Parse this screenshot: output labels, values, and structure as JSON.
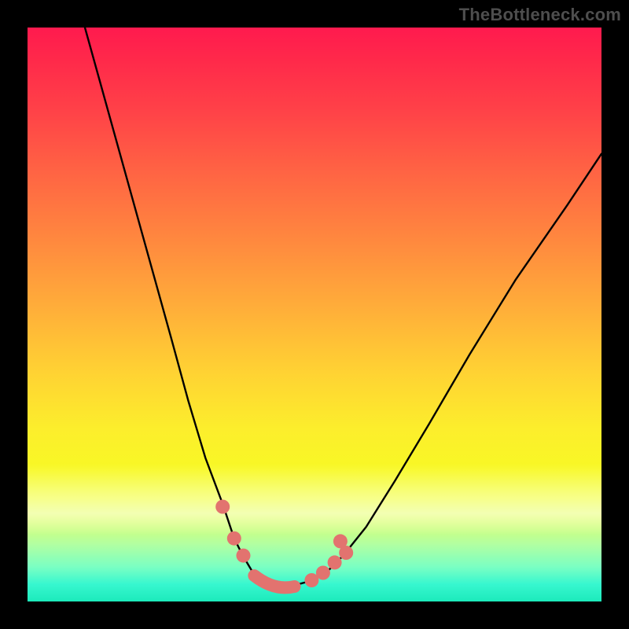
{
  "watermark": "TheBottleneck.com",
  "colors": {
    "frame": "#000000",
    "curve": "#000000",
    "marker": "#e2736f",
    "watermark": "#4e4e4e"
  },
  "chart_data": {
    "type": "line",
    "title": "",
    "xlabel": "",
    "ylabel": "",
    "xlim": [
      0,
      100
    ],
    "ylim": [
      0,
      100
    ],
    "grid": false,
    "legend": false,
    "series": [
      {
        "name": "bottleneck-curve",
        "x": [
          10,
          15,
          20,
          25,
          28,
          31,
          34,
          36,
          37.5,
          39,
          40.5,
          42,
          43.5,
          46,
          49,
          52,
          55,
          59,
          64,
          70,
          77,
          85,
          94,
          100
        ],
        "y": [
          100,
          82,
          64,
          46,
          35,
          25,
          17,
          11,
          8,
          5.5,
          3.5,
          2.8,
          2.5,
          2.7,
          3.5,
          5,
          8,
          13,
          21,
          31,
          43,
          56,
          69,
          78
        ]
      }
    ],
    "markers": [
      {
        "type": "dot",
        "x": 34.0,
        "y": 16.5
      },
      {
        "type": "dot",
        "x": 36.0,
        "y": 11.0
      },
      {
        "type": "dot",
        "x": 37.6,
        "y": 8.0
      },
      {
        "type": "segment",
        "x0": 39.5,
        "y0": 4.5,
        "x1": 46.5,
        "y1": 2.6
      },
      {
        "type": "dot",
        "x": 49.5,
        "y": 3.7
      },
      {
        "type": "dot",
        "x": 51.5,
        "y": 5.0
      },
      {
        "type": "dot",
        "x": 53.5,
        "y": 6.8
      },
      {
        "type": "dot",
        "x": 54.5,
        "y": 10.5
      },
      {
        "type": "dot",
        "x": 55.5,
        "y": 8.5
      }
    ]
  }
}
